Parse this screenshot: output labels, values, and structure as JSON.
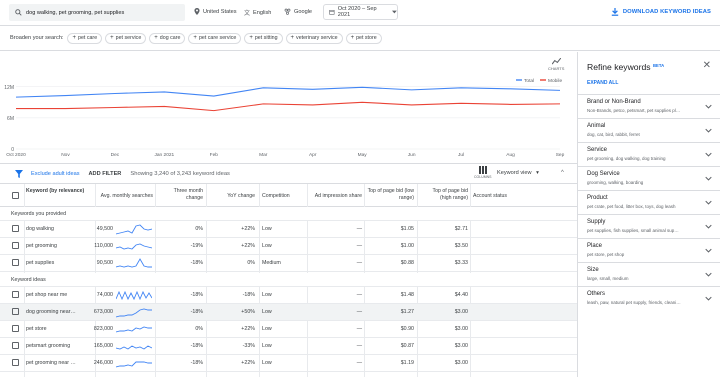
{
  "topbar": {
    "search_value": "dog walking, pet grooming, pet supplies",
    "location": "United States",
    "language": "English",
    "network": "Google",
    "date_range": "Oct 2020 – Sep 2021",
    "download_label": "DOWNLOAD KEYWORD IDEAS"
  },
  "broaden": {
    "label": "Broaden your search:",
    "chips": [
      "pet care",
      "pet service",
      "dog care",
      "pet care service",
      "pet sitting",
      "veterinary service",
      "pet store"
    ]
  },
  "chart_data": {
    "type": "line",
    "x": [
      "Oct 2020",
      "Nov",
      "Dec",
      "Jan 2021",
      "Feb",
      "Mar",
      "Apr",
      "May",
      "Jun",
      "Jul",
      "Aug",
      "Sep"
    ],
    "series": [
      {
        "name": "Total",
        "color": "#4285f4",
        "values": [
          10.0,
          10.3,
          10.7,
          11.0,
          10.2,
          11.8,
          11.5,
          11.9,
          11.4,
          11.8,
          11.6,
          11.3
        ]
      },
      {
        "name": "Mobile",
        "color": "#ea4335",
        "values": [
          7.8,
          7.8,
          8.0,
          8.2,
          7.4,
          8.7,
          8.5,
          9.0,
          8.5,
          8.8,
          8.6,
          8.7
        ]
      }
    ],
    "ytick_labels": [
      "12M",
      "6M",
      "0"
    ],
    "ylim": [
      0,
      16
    ],
    "legend_position": "top-right",
    "icon_caption": "CHARTS"
  },
  "toolbar": {
    "exclude_label": "Exclude adult ideas",
    "add_filter_label": "ADD FILTER",
    "showing_text": "Showing 3,240 of 3,243 keyword ideas",
    "columns_label": "COLUMNS",
    "keyword_view_label": "Keyword view"
  },
  "table": {
    "headers": {
      "keyword": "Keyword (by relevance)",
      "avg": "Avg. monthly searches",
      "three_month": "Three month change",
      "yoy": "YoY change",
      "competition": "Competition",
      "impression": "Ad impression share",
      "bid_low": "Top of page bid (low range)",
      "bid_high": "Top of page bid (high range)",
      "status": "Account status"
    },
    "section_provided": "Keywords you provided",
    "section_ideas": "Keyword ideas",
    "provided": [
      {
        "keyword": "dog walking",
        "avg": "49,500",
        "three": "0%",
        "yoy": "+22%",
        "comp": "Low",
        "imp": "—",
        "low": "$1.05",
        "high": "$2.71"
      },
      {
        "keyword": "pet grooming",
        "avg": "110,000",
        "three": "-19%",
        "yoy": "+22%",
        "comp": "Low",
        "imp": "—",
        "low": "$1.00",
        "high": "$3.50"
      },
      {
        "keyword": "pet supplies",
        "avg": "90,500",
        "three": "-18%",
        "yoy": "0%",
        "comp": "Medium",
        "imp": "—",
        "low": "$0.88",
        "high": "$3.33"
      }
    ],
    "ideas": [
      {
        "keyword": "pet shop near me",
        "avg": "74,000",
        "three": "-18%",
        "yoy": "-18%",
        "comp": "Low",
        "imp": "—",
        "low": "$1.48",
        "high": "$4.40"
      },
      {
        "keyword": "dog grooming near…",
        "avg": "673,000",
        "three": "-18%",
        "yoy": "+50%",
        "comp": "Low",
        "imp": "—",
        "low": "$1.27",
        "high": "$3.00"
      },
      {
        "keyword": "pet store",
        "avg": "823,000",
        "three": "0%",
        "yoy": "+22%",
        "comp": "Low",
        "imp": "—",
        "low": "$0.90",
        "high": "$3.00"
      },
      {
        "keyword": "petsmart grooming",
        "avg": "165,000",
        "three": "-18%",
        "yoy": "-33%",
        "comp": "Low",
        "imp": "—",
        "low": "$0.87",
        "high": "$3.00"
      },
      {
        "keyword": "pet grooming near …",
        "avg": "246,000",
        "three": "-18%",
        "yoy": "+22%",
        "comp": "Low",
        "imp": "—",
        "low": "$1.19",
        "high": "$3.00"
      }
    ]
  },
  "refine": {
    "title": "Refine keywords",
    "beta": "BETA",
    "expand_all": "EXPAND ALL",
    "groups": [
      {
        "title": "Brand or Non-Brand",
        "sub": "Non-Brands, petco, petsmart, pet supplies pl…"
      },
      {
        "title": "Animal",
        "sub": "dog, cat, bird, rabbit, ferret"
      },
      {
        "title": "Service",
        "sub": "pet grooming, dog walking, dog training"
      },
      {
        "title": "Dog Service",
        "sub": "grooming, walking, boarding"
      },
      {
        "title": "Product",
        "sub": "pet crate, pet food, litter box, toys, dog leash"
      },
      {
        "title": "Supply",
        "sub": "pet supplies, fish supplies, small animal sup…"
      },
      {
        "title": "Place",
        "sub": "pet store, pet shop"
      },
      {
        "title": "Size",
        "sub": "large, small, medium"
      },
      {
        "title": "Others",
        "sub": "leash, paw, natural pet supply, friends, cleani…"
      }
    ]
  }
}
